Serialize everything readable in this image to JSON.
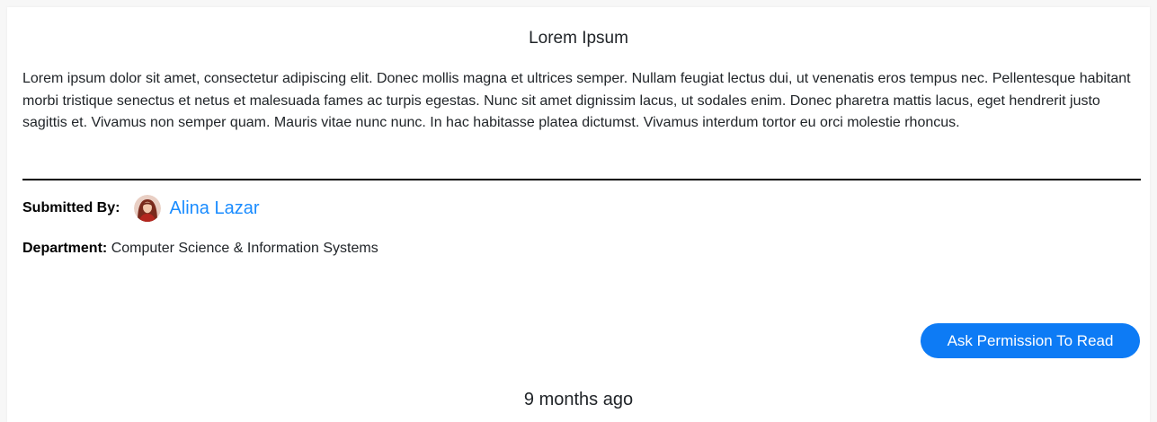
{
  "post": {
    "title": "Lorem Ipsum",
    "body": "Lorem ipsum dolor sit amet, consectetur adipiscing elit. Donec mollis magna et ultrices semper. Nullam feugiat lectus dui, ut venenatis eros tempus nec. Pellentesque habitant morbi tristique senectus et netus et malesuada fames ac turpis egestas. Nunc sit amet dignissim lacus, ut sodales enim. Donec pharetra mattis lacus, eget hendrerit justo sagittis et. Vivamus non semper quam. Mauris vitae nunc nunc. In hac habitasse platea dictumst. Vivamus interdum tortor eu orci molestie rhoncus.",
    "submitted_label": "Submitted By:",
    "author_name": "Alina Lazar",
    "author_avatar_icon": "user-avatar-icon",
    "department_label": "Department:",
    "department_value": "Computer Science & Information Systems",
    "action_button_label": "Ask Permission To Read",
    "timestamp": "9 months ago"
  },
  "colors": {
    "link": "#1a8cff",
    "button_bg": "#0d7bf5",
    "button_text": "#ffffff",
    "divider": "#000000"
  }
}
